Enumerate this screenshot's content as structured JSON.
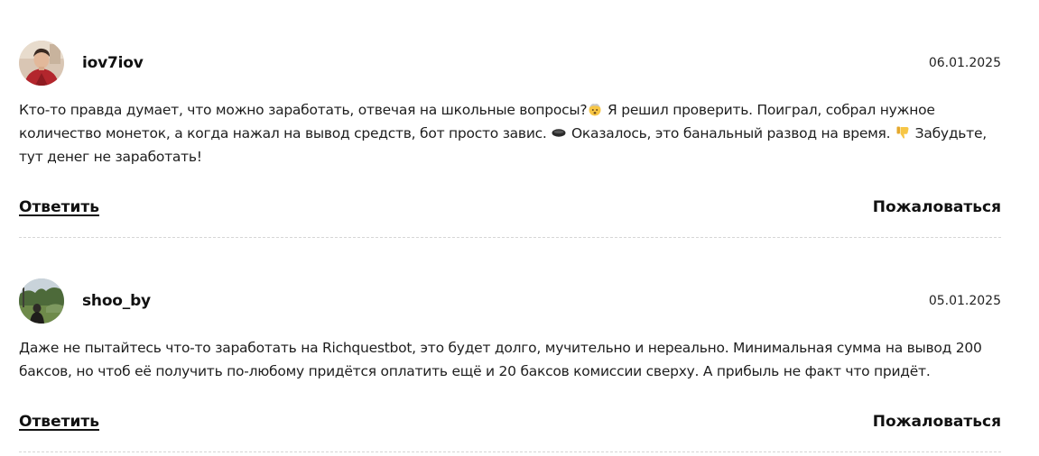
{
  "comments": [
    {
      "author": "iov7iov",
      "date": "06.01.2025",
      "text_parts": [
        "Кто-то правда думает, что можно заработать, отвечая на школьные вопросы?",
        " Я решил проверить. Поиграл, собрал нужное количество монеток, а когда нажал на вывод средств, бот просто завис. ",
        " Оказалось, это банальный развод на время. ",
        " Забудьте, тут денег не заработать!"
      ],
      "emojis": [
        "exploding-head-emoji",
        "black-circle-emoji",
        "thumbs-down-emoji"
      ],
      "reply_label": "Ответить",
      "report_label": "Пожаловаться"
    },
    {
      "author": "shoo_by",
      "date": "05.01.2025",
      "text": "Даже не пытайтесь что-то заработать на Richquestbot, это будет долго, мучительно и нереально. Минимальная сумма на вывод 200 баксов, но чтоб её получить по-любому придётся оплатить ещё и 20 баксов комиссии сверху. А прибыль не факт что придёт.",
      "reply_label": "Ответить",
      "report_label": "Пожаловаться"
    }
  ]
}
